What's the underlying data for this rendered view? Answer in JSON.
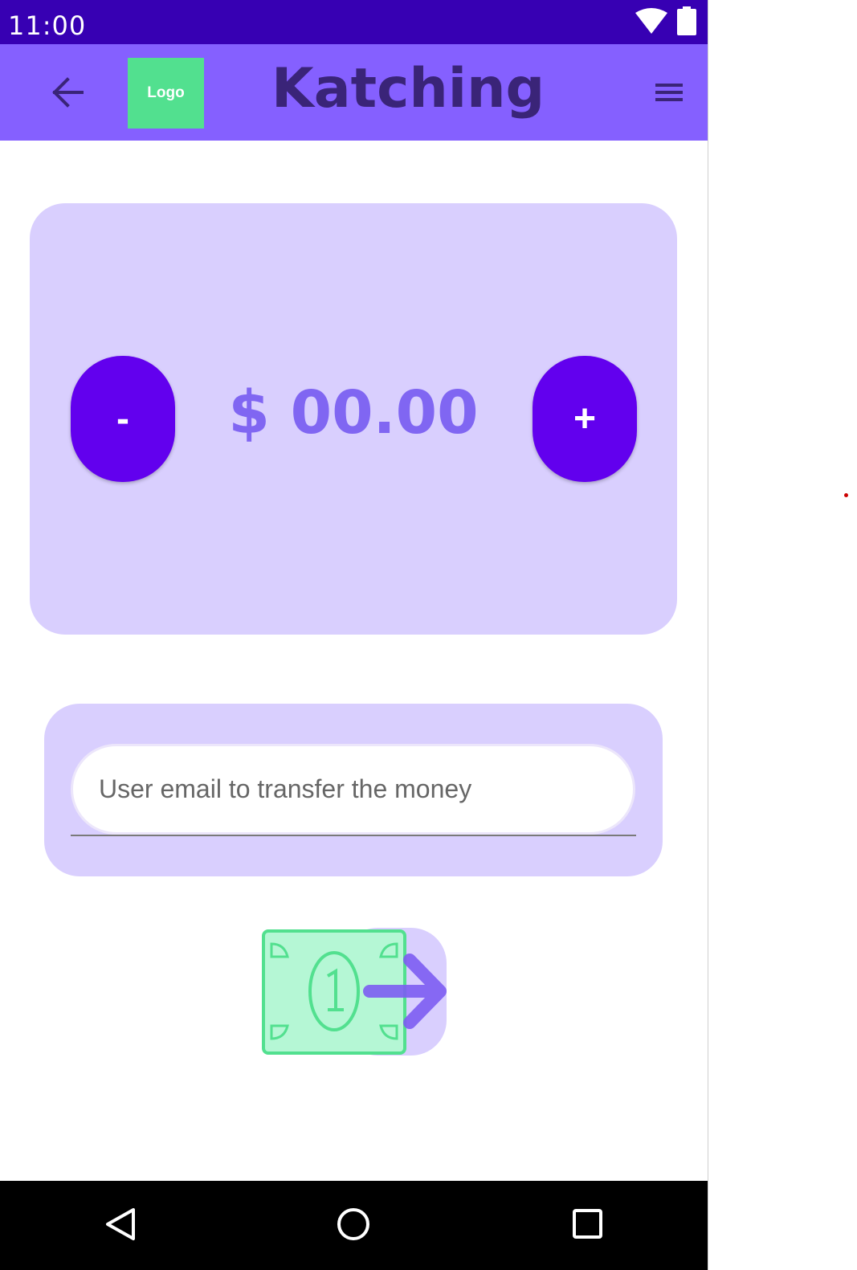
{
  "status_bar": {
    "time": "11:00",
    "icons": [
      "wifi-icon",
      "battery-icon"
    ]
  },
  "app_bar": {
    "back_icon": "arrow-left-icon",
    "logo_label": "Logo",
    "title": "Katching",
    "menu_icon": "hamburger-menu-icon"
  },
  "amount": {
    "decrement_label": "-",
    "increment_label": "+",
    "display": "$ 00.00"
  },
  "transfer": {
    "email_placeholder": "User email to transfer the money",
    "email_value": "",
    "send_icon": "money-transfer-icon"
  },
  "nav_bar": {
    "icons": [
      "back-triangle-icon",
      "home-circle-icon",
      "recents-square-icon"
    ]
  },
  "colors": {
    "status_bar": "#3700b3",
    "app_bar": "#8560ff",
    "card": "#d9cffe",
    "button": "#6200ee",
    "amount_text": "#8066f2",
    "logo": "#52e08f",
    "title": "#3a2478"
  }
}
